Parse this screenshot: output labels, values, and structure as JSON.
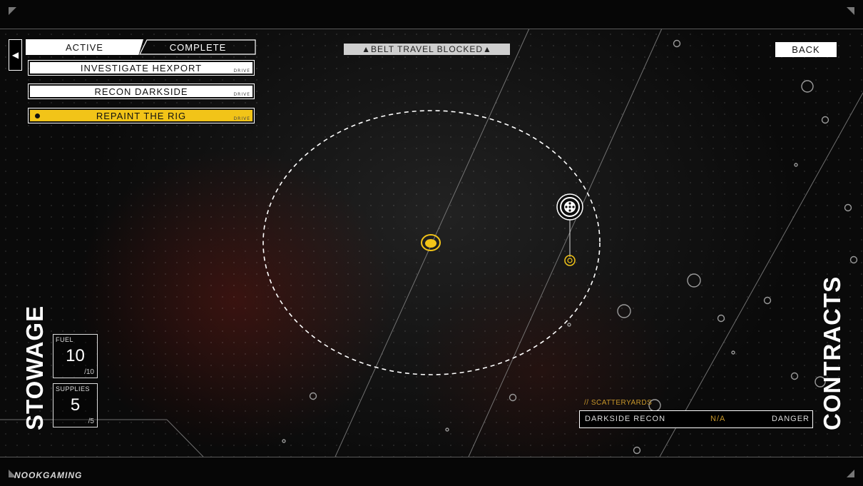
{
  "tabs": {
    "active_label": "ACTIVE",
    "complete_label": "COMPLETE"
  },
  "contracts": [
    {
      "label": "INVESTIGATE HEXPORT",
      "tag": "DRIVE",
      "selected": false
    },
    {
      "label": "RECON DARKSIDE",
      "tag": "DRIVE",
      "selected": false
    },
    {
      "label": "REPAINT THE RIG",
      "tag": "DRIVE",
      "selected": true
    }
  ],
  "banner": {
    "text": "▲BELT TRAVEL BLOCKED▲"
  },
  "back_button": {
    "label": "BACK"
  },
  "stowage": {
    "title": "STOWAGE",
    "fuel": {
      "label": "FUEL",
      "value": "10",
      "max": "/10"
    },
    "supplies": {
      "label": "SUPPLIES",
      "value": "5",
      "max": "/5"
    }
  },
  "contracts_panel": {
    "title": "CONTRACTS",
    "location": "// SCATTERYARDS",
    "row": {
      "name": "DARKSIDE RECON",
      "value": "N/A",
      "risk": "DANGER"
    }
  },
  "watermark": "NOOKGAMING",
  "colors": {
    "accent_yellow": "#f2c418",
    "accent_orange": "#c8972a",
    "panel_white": "#ffffff"
  },
  "icons": {
    "back_arrow": "left-triangle-icon",
    "target_marker": "location-target-icon",
    "player_marker": "player-position-icon"
  }
}
